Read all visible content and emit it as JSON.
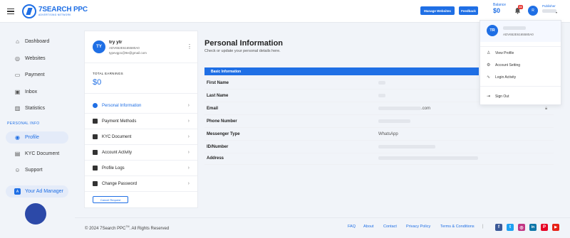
{
  "header": {
    "logo_title": "7SEARCH PPC",
    "logo_sub": "ADVERTISING NETWORK",
    "manage_websites": "Manage Websites",
    "feedback": "Feedback",
    "balance_label": "Balance",
    "balance_value": "$0",
    "notification_count": "24",
    "avatar_initials": "R",
    "role": "Publisher"
  },
  "sidebar": {
    "items": [
      {
        "label": "Dashboard"
      },
      {
        "label": "Websites"
      },
      {
        "label": "Payment"
      },
      {
        "label": "Inbox"
      },
      {
        "label": "Statistics"
      }
    ],
    "section_label": "PERSONAL INFO",
    "personal_items": [
      {
        "label": "Profile"
      },
      {
        "label": "KYC Document"
      },
      {
        "label": "Support"
      }
    ],
    "ad_manager": "Your Ad Manager"
  },
  "profile_card": {
    "initials": "TY",
    "name": "try ytr",
    "id": "ADV652E6165580A0",
    "email": "typevgp1@9e@gmail.com",
    "earnings_label": "TOTAL EARNINGS",
    "earnings_value": "$0",
    "menu": [
      {
        "label": "Personal Information"
      },
      {
        "label": "Payment Methods"
      },
      {
        "label": "KYC Document"
      },
      {
        "label": "Account Activity"
      },
      {
        "label": "Profile Logs"
      },
      {
        "label": "Change Password"
      }
    ],
    "cancel_request": "Cancel Request"
  },
  "personal_info": {
    "title": "Personal Information",
    "subtitle": "Check or update your personal details here.",
    "section": "Basic Information",
    "rows": [
      {
        "label": "First Name",
        "value": ""
      },
      {
        "label": "Last Name",
        "value": ""
      },
      {
        "label": "Email",
        "value": ".com"
      },
      {
        "label": "Phone Number",
        "value": ""
      },
      {
        "label": "Messenger Type",
        "value": "WhatsApp"
      },
      {
        "label": "ID/Number",
        "value": ""
      },
      {
        "label": "Address",
        "value": ""
      }
    ]
  },
  "dropdown": {
    "initials": "TR",
    "id": "ADV652E6165580A0",
    "items": [
      {
        "label": "View Profile"
      },
      {
        "label": "Account Setting"
      },
      {
        "label": "Login Activity"
      }
    ],
    "sign_out": "Sign Out"
  },
  "footer": {
    "copyright": "© 2024 7Search PPC",
    "tm": "TM",
    "rights": ". All Rights Reserved",
    "links": [
      "FAQ",
      "About",
      "Contact",
      "Privacy Policy",
      "Terms & Conditions"
    ],
    "social": [
      {
        "name": "facebook-icon",
        "glyph": "f",
        "color": "#3b5998"
      },
      {
        "name": "twitter-icon",
        "glyph": "t",
        "color": "#1da1f2"
      },
      {
        "name": "instagram-icon",
        "glyph": "◎",
        "color": "#c13584"
      },
      {
        "name": "linkedin-icon",
        "glyph": "in",
        "color": "#0e76a8"
      },
      {
        "name": "pinterest-icon",
        "glyph": "P",
        "color": "#e60023"
      },
      {
        "name": "youtube-icon",
        "glyph": "▶",
        "color": "#e62117"
      }
    ]
  },
  "colors": {
    "accent": "#1f6fe5",
    "background": "#f1f4f9"
  }
}
